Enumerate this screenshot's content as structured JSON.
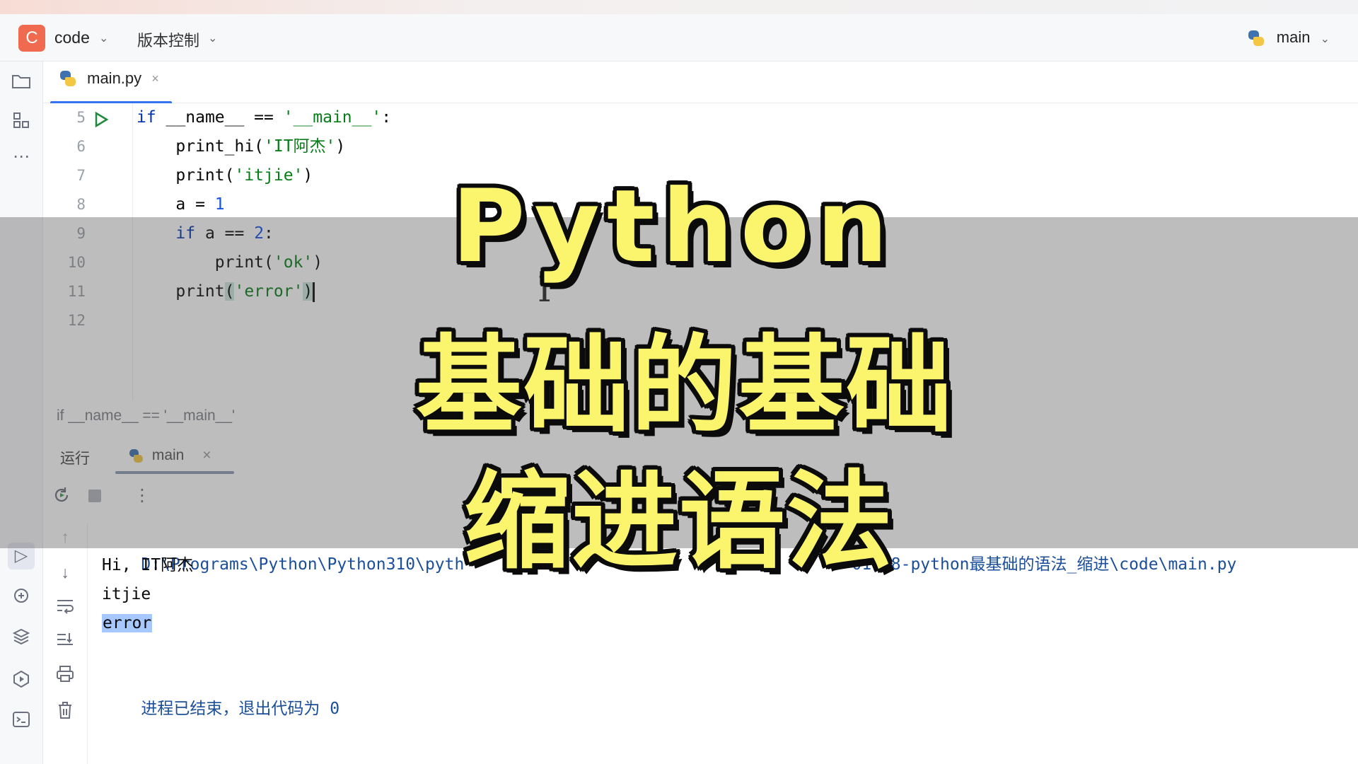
{
  "titlebar": {
    "project_icon_letter": "C",
    "project_name": "code",
    "vcs_label": "版本控制",
    "run_config_label": "main"
  },
  "editor": {
    "tab_label": "main.py",
    "tab_close": "×",
    "line_numbers": [
      "5",
      "6",
      "7",
      "8",
      "9",
      "10",
      "11",
      "12"
    ],
    "breadcrumb": "if __name__ == '__main__'"
  },
  "run_panel": {
    "title": "运行",
    "tab_label": "main",
    "tab_close": "×"
  },
  "console": {
    "path_prefix": "D:\\Programs\\Python\\Python310\\pyth",
    "path_suffix": "01-18-python最基础的语法_缩进\\code\\main.py",
    "output_line1": "Hi, IT阿杰",
    "output_line2": "itjie",
    "output_line3": "error",
    "exit_text": "进程已结束，退出代码为 ",
    "exit_code": "0"
  },
  "banner": {
    "line1": "Python",
    "line2": "基础的基础",
    "line3": "缩进语法"
  },
  "colors": {
    "accent_blue": "#3574f0",
    "banner_yellow": "#fbf56e",
    "project_icon": "#ef6a4f"
  }
}
